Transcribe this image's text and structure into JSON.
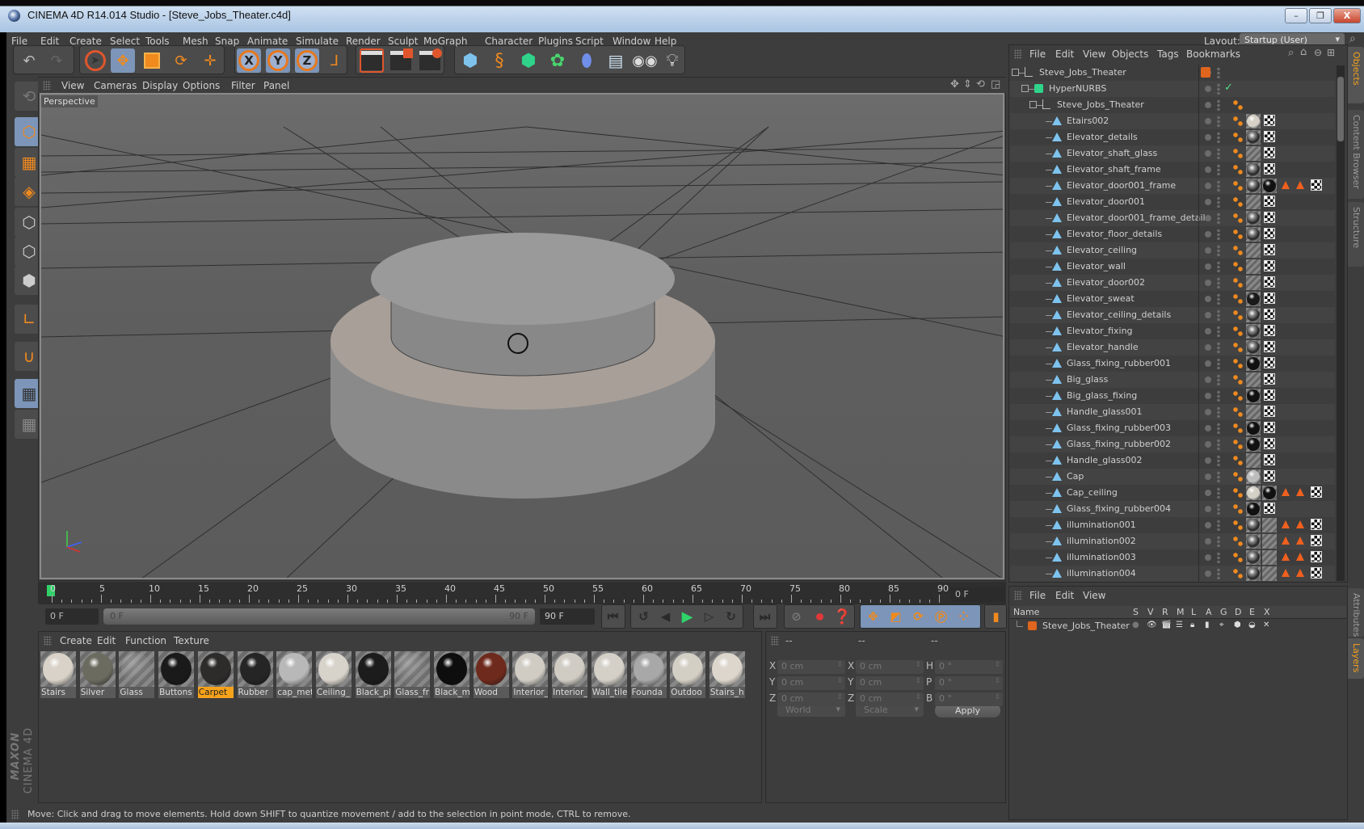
{
  "window": {
    "title": "CINEMA 4D R14.014 Studio - [Steve_Jobs_Theater.c4d]",
    "minimize_label": "–",
    "restore_label": "❐",
    "close_label": "X"
  },
  "menubar": {
    "items": [
      "File",
      "Edit",
      "Create",
      "Select",
      "Tools",
      "Mesh",
      "Snap",
      "Animate",
      "Simulate",
      "Render",
      "Sculpt",
      "MoGraph",
      "Character",
      "Plugins",
      "Script",
      "Window",
      "Help"
    ],
    "layout_label": "Layout:",
    "layout_value": "Startup (User)"
  },
  "toolbar": {
    "undo": "↶",
    "redo": "↷",
    "axis_x": "X",
    "axis_y": "Y",
    "axis_z": "Z"
  },
  "viewport": {
    "menu": [
      "View",
      "Cameras",
      "Display",
      "Options",
      "Filter",
      "Panel"
    ],
    "camera_label": "Perspective"
  },
  "timeline": {
    "ticks": [
      "0",
      "5",
      "10",
      "15",
      "20",
      "25",
      "30",
      "35",
      "40",
      "45",
      "50",
      "55",
      "60",
      "65",
      "70",
      "75",
      "80",
      "85",
      "90"
    ],
    "current_frame": "0 F",
    "start_frame": "0 F",
    "range_start": "0 F",
    "range_end": "90 F",
    "end_frame": "90 F"
  },
  "materials": {
    "menu": [
      "Create",
      "Edit",
      "Function",
      "Texture"
    ],
    "items": [
      {
        "name": "Stairs",
        "color": "#d8d2c8",
        "selected": false
      },
      {
        "name": "Silver",
        "color": "#6b6b60",
        "selected": false
      },
      {
        "name": "Glass",
        "color": "transparent",
        "selected": false
      },
      {
        "name": "Buttons",
        "color": "#1a1a1a",
        "selected": false
      },
      {
        "name": "Carpet",
        "color": "#2e2b2b",
        "selected": true
      },
      {
        "name": "Rubber",
        "color": "#252525",
        "selected": false
      },
      {
        "name": "cap_met",
        "color": "#b8b8b8",
        "selected": false
      },
      {
        "name": "Ceiling_",
        "color": "#d8d3ca",
        "selected": false
      },
      {
        "name": "Black_pl",
        "color": "#1c1c1c",
        "selected": false
      },
      {
        "name": "Glass_fr",
        "color": "transparent",
        "selected": false
      },
      {
        "name": "Black_m",
        "color": "#0e0e0e",
        "selected": false
      },
      {
        "name": "Wood",
        "color": "#6e2a1c",
        "selected": false
      },
      {
        "name": "Interior_",
        "color": "#d0ccc4",
        "selected": false
      },
      {
        "name": "Interior_",
        "color": "#d0ccc4",
        "selected": false
      },
      {
        "name": "Wall_tile",
        "color": "#d4d0c8",
        "selected": false
      },
      {
        "name": "Founda",
        "color": "#a8a8a8",
        "selected": false
      },
      {
        "name": "Outdoo",
        "color": "#d4cfc5",
        "selected": false
      },
      {
        "name": "Stairs_h",
        "color": "#dcd6cc",
        "selected": false
      }
    ]
  },
  "coordinates": {
    "headers": [
      "--",
      "--",
      "--"
    ],
    "rows": [
      {
        "l1": "X",
        "v1": "0 cm",
        "l2": "X",
        "v2": "0 cm",
        "l3": "H",
        "v3": "0 °"
      },
      {
        "l1": "Y",
        "v1": "0 cm",
        "l2": "Y",
        "v2": "0 cm",
        "l3": "P",
        "v3": "0 °"
      },
      {
        "l1": "Z",
        "v1": "0 cm",
        "l2": "Z",
        "v2": "0 cm",
        "l3": "B",
        "v3": "0 °"
      }
    ],
    "space": "World",
    "mode": "Scale",
    "apply_label": "Apply"
  },
  "objects": {
    "menu": [
      "File",
      "Edit",
      "View",
      "Objects",
      "Tags",
      "Bookmarks"
    ],
    "items": [
      {
        "name": "Steve_Jobs_Theater",
        "type": "null",
        "level": 0
      },
      {
        "name": "HyperNURBS",
        "type": "nurbs",
        "level": 1
      },
      {
        "name": "Steve_Jobs_Theater",
        "type": "null",
        "level": 2
      },
      {
        "name": "Etairs002",
        "type": "poly",
        "level": 3,
        "mats": [
          "#d6d0c6"
        ],
        "warn": false
      },
      {
        "name": "Elevator_details",
        "type": "poly",
        "level": 3,
        "mats": [
          "chrome"
        ],
        "warn": false
      },
      {
        "name": "Elevator_shaft_glass",
        "type": "poly",
        "level": 3,
        "mats": [
          "glass"
        ],
        "warn": false
      },
      {
        "name": "Elevator_shaft_frame",
        "type": "poly",
        "level": 3,
        "mats": [
          "chrome"
        ],
        "warn": false
      },
      {
        "name": "Elevator_door001_frame",
        "type": "poly",
        "level": 3,
        "mats": [
          "chrome",
          "#111"
        ],
        "warn": true
      },
      {
        "name": "Elevator_door001",
        "type": "poly",
        "level": 3,
        "mats": [
          "glass"
        ],
        "warn": false
      },
      {
        "name": "Elevator_door001_frame_details",
        "type": "poly",
        "level": 3,
        "mats": [
          "chrome"
        ],
        "warn": false
      },
      {
        "name": "Elevator_floor_details",
        "type": "poly",
        "level": 3,
        "mats": [
          "chrome"
        ],
        "warn": false
      },
      {
        "name": "Elevator_ceiling",
        "type": "poly",
        "level": 3,
        "mats": [
          "glass"
        ],
        "warn": false
      },
      {
        "name": "Elevator_wall",
        "type": "poly",
        "level": 3,
        "mats": [
          "glass"
        ],
        "warn": false
      },
      {
        "name": "Elevator_door002",
        "type": "poly",
        "level": 3,
        "mats": [
          "glass"
        ],
        "warn": false
      },
      {
        "name": "Elevator_sweat",
        "type": "poly",
        "level": 3,
        "mats": [
          "#1a1a1a"
        ],
        "warn": false
      },
      {
        "name": "Elevator_ceiling_details",
        "type": "poly",
        "level": 3,
        "mats": [
          "chrome"
        ],
        "warn": false
      },
      {
        "name": "Elevator_fixing",
        "type": "poly",
        "level": 3,
        "mats": [
          "chrome"
        ],
        "warn": false
      },
      {
        "name": "Elevator_handle",
        "type": "poly",
        "level": 3,
        "mats": [
          "chrome"
        ],
        "warn": false
      },
      {
        "name": "Glass_fixing_rubber001",
        "type": "poly",
        "level": 3,
        "mats": [
          "#111"
        ],
        "warn": false
      },
      {
        "name": "Big_glass",
        "type": "poly",
        "level": 3,
        "mats": [
          "glass"
        ],
        "warn": false
      },
      {
        "name": "Big_glass_fixing",
        "type": "poly",
        "level": 3,
        "mats": [
          "#111"
        ],
        "warn": false
      },
      {
        "name": "Handle_glass001",
        "type": "poly",
        "level": 3,
        "mats": [
          "glass"
        ],
        "warn": false
      },
      {
        "name": "Glass_fixing_rubber003",
        "type": "poly",
        "level": 3,
        "mats": [
          "#111"
        ],
        "warn": false
      },
      {
        "name": "Glass_fixing_rubber002",
        "type": "poly",
        "level": 3,
        "mats": [
          "#111"
        ],
        "warn": false
      },
      {
        "name": "Handle_glass002",
        "type": "poly",
        "level": 3,
        "mats": [
          "glass"
        ],
        "warn": false
      },
      {
        "name": "Cap",
        "type": "poly",
        "level": 3,
        "mats": [
          "#bdbdbd"
        ],
        "warn": false
      },
      {
        "name": "Cap_ceiling",
        "type": "poly",
        "level": 3,
        "mats": [
          "#d4d0c6",
          "#111"
        ],
        "warn": true
      },
      {
        "name": "Glass_fixing_rubber004",
        "type": "poly",
        "level": 3,
        "mats": [
          "#111"
        ],
        "warn": false
      },
      {
        "name": "illumination001",
        "type": "poly",
        "level": 3,
        "mats": [
          "chrome",
          "glass"
        ],
        "warn": true
      },
      {
        "name": "illumination002",
        "type": "poly",
        "level": 3,
        "mats": [
          "chrome",
          "glass"
        ],
        "warn": true
      },
      {
        "name": "illumination003",
        "type": "poly",
        "level": 3,
        "mats": [
          "chrome",
          "glass"
        ],
        "warn": true
      },
      {
        "name": "illumination004",
        "type": "poly",
        "level": 3,
        "mats": [
          "chrome",
          "glass"
        ],
        "warn": true
      }
    ]
  },
  "side_tabs": {
    "top": [
      "Objects",
      "Content Browser",
      "Structure"
    ],
    "bottom": [
      "Attributes",
      "Layers"
    ]
  },
  "layers": {
    "menu": [
      "File",
      "Edit",
      "View"
    ],
    "headers": [
      "Name",
      "S",
      "V",
      "R",
      "M",
      "L",
      "A",
      "G",
      "D",
      "E",
      "X"
    ],
    "rows": [
      {
        "name": "Steve_Jobs_Theater",
        "color": "#e0651e"
      }
    ]
  },
  "status": {
    "text": "Move: Click and drag to move elements. Hold down SHIFT to quantize movement / add to the selection in point mode, CTRL to remove."
  },
  "branding": {
    "maxon": "MAXON",
    "product": "CINEMA 4D"
  }
}
